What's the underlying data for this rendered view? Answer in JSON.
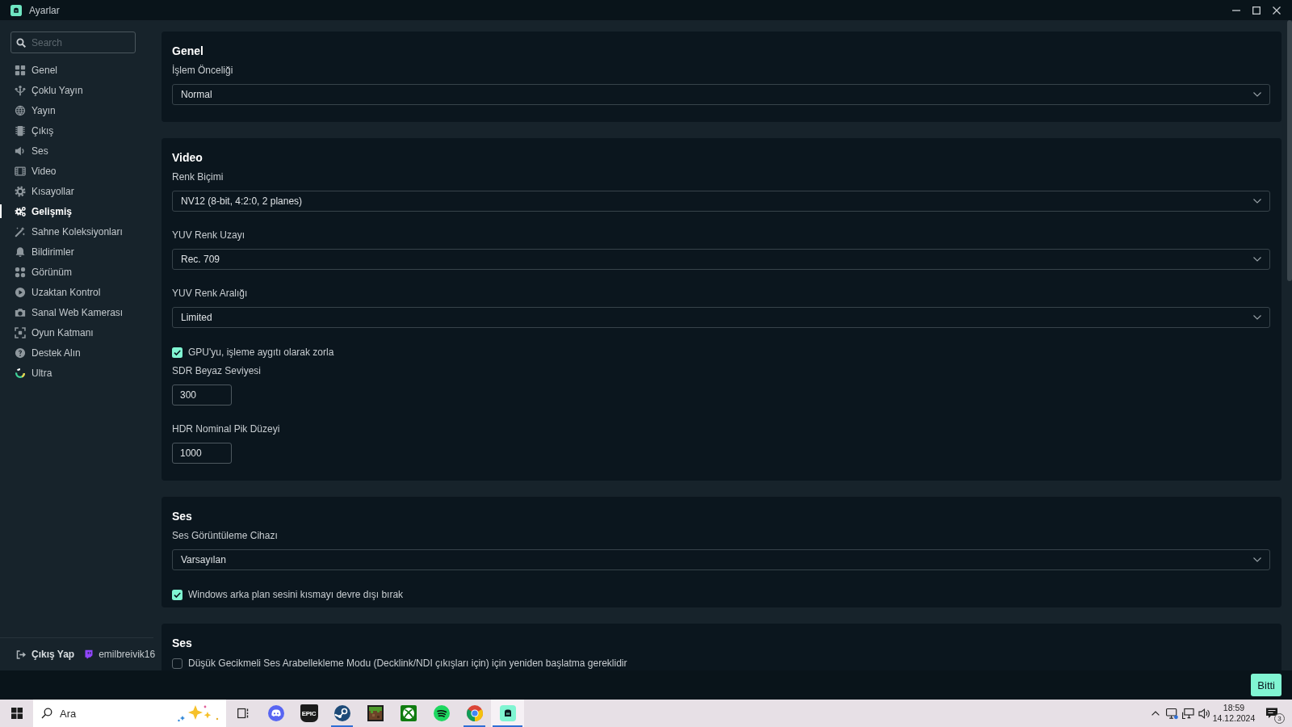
{
  "window": {
    "title": "Ayarlar"
  },
  "sidebar": {
    "search": {
      "placeholder": "Search"
    },
    "items": [
      {
        "label": "Genel",
        "selected": false
      },
      {
        "label": "Çoklu Yayın",
        "selected": false
      },
      {
        "label": "Yayın",
        "selected": false
      },
      {
        "label": "Çıkış",
        "selected": false
      },
      {
        "label": "Ses",
        "selected": false
      },
      {
        "label": "Video",
        "selected": false
      },
      {
        "label": "Kısayollar",
        "selected": false
      },
      {
        "label": "Gelişmiş",
        "selected": true
      },
      {
        "label": "Sahne Koleksiyonları",
        "selected": false
      },
      {
        "label": "Bildirimler",
        "selected": false
      },
      {
        "label": "Görünüm",
        "selected": false
      },
      {
        "label": "Uzaktan Kontrol",
        "selected": false
      },
      {
        "label": "Sanal Web Kamerası",
        "selected": false
      },
      {
        "label": "Oyun Katmanı",
        "selected": false
      },
      {
        "label": "Destek Alın",
        "selected": false
      },
      {
        "label": "Ultra",
        "selected": false
      }
    ],
    "footer": {
      "logout": "Çıkış Yap",
      "account": "emilbreivik16"
    }
  },
  "sections": [
    {
      "title": "Genel",
      "fields": [
        {
          "kind": "select",
          "label": "İşlem Önceliği",
          "value": "Normal"
        }
      ]
    },
    {
      "title": "Video",
      "fields": [
        {
          "kind": "select",
          "label": "Renk Biçimi",
          "value": "NV12 (8-bit, 4:2:0, 2 planes)"
        },
        {
          "kind": "select",
          "label": "YUV Renk Uzayı",
          "value": "Rec. 709"
        },
        {
          "kind": "select",
          "label": "YUV Renk Aralığı",
          "value": "Limited"
        },
        {
          "kind": "checkbox",
          "label": "GPU'yu, işleme aygıtı olarak zorla",
          "checked": true
        },
        {
          "kind": "number",
          "label": "SDR Beyaz Seviyesi",
          "value": "300"
        },
        {
          "kind": "number",
          "label": "HDR Nominal Pik Düzeyi",
          "value": "1000"
        }
      ]
    },
    {
      "title": "Ses",
      "fields": [
        {
          "kind": "select",
          "label": "Ses Görüntüleme Cihazı",
          "value": "Varsayılan"
        },
        {
          "kind": "checkbox",
          "label": "Windows arka plan sesini kısmayı devre dışı bırak",
          "checked": true
        }
      ]
    },
    {
      "title": "Ses",
      "fields": [
        {
          "kind": "checkbox",
          "label": "Düşük Gecikmeli Ses Arabellekleme Modu (Decklink/NDI çıkışları için) için yeniden başlatma gereklidir",
          "checked": false
        }
      ]
    }
  ],
  "footer": {
    "done_button": "Bitti"
  },
  "taskbar": {
    "search": {
      "placeholder": "Ara"
    },
    "apps": [
      {
        "running": false,
        "active": false
      },
      {
        "label": "EPIC",
        "running": false,
        "active": false
      },
      {
        "running": true,
        "active": false
      },
      {
        "running": false,
        "active": false
      },
      {
        "running": false,
        "active": false
      },
      {
        "running": false,
        "active": false
      },
      {
        "running": true,
        "active": false
      },
      {
        "running": true,
        "active": true
      }
    ],
    "clock": {
      "time": "18:59",
      "date": "14.12.2024"
    },
    "notification_count": "3"
  }
}
